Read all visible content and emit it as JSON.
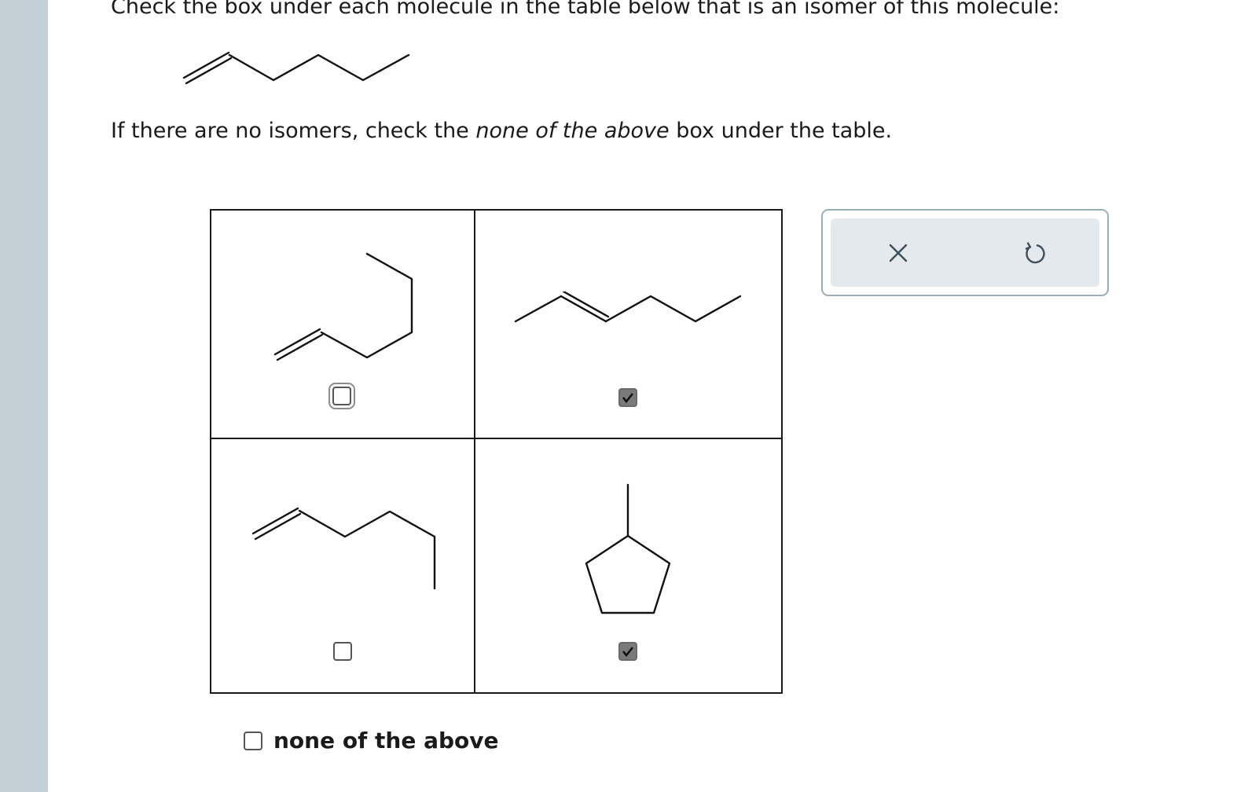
{
  "question": {
    "line1": "Check the box under each molecule in the table below that is an isomer of this molecule:",
    "line2_before": "If there are no isomers, check the ",
    "line2_emphasis": "none of the above",
    "line2_after": " box under the table."
  },
  "choices": [
    {
      "id": "choice-1",
      "checked": false
    },
    {
      "id": "choice-2",
      "checked": true
    },
    {
      "id": "choice-3",
      "checked": false
    },
    {
      "id": "choice-4",
      "checked": true
    }
  ],
  "none_option": {
    "label": "none of the above",
    "checked": false
  },
  "toolbar": {
    "icons": [
      "close-icon",
      "undo-icon"
    ]
  },
  "colors": {
    "rail": "#c3d0d6",
    "toolbar_bg": "#e3e9ec",
    "toolbar_border": "#9ab0b9",
    "checked": "#7a7a7a"
  }
}
